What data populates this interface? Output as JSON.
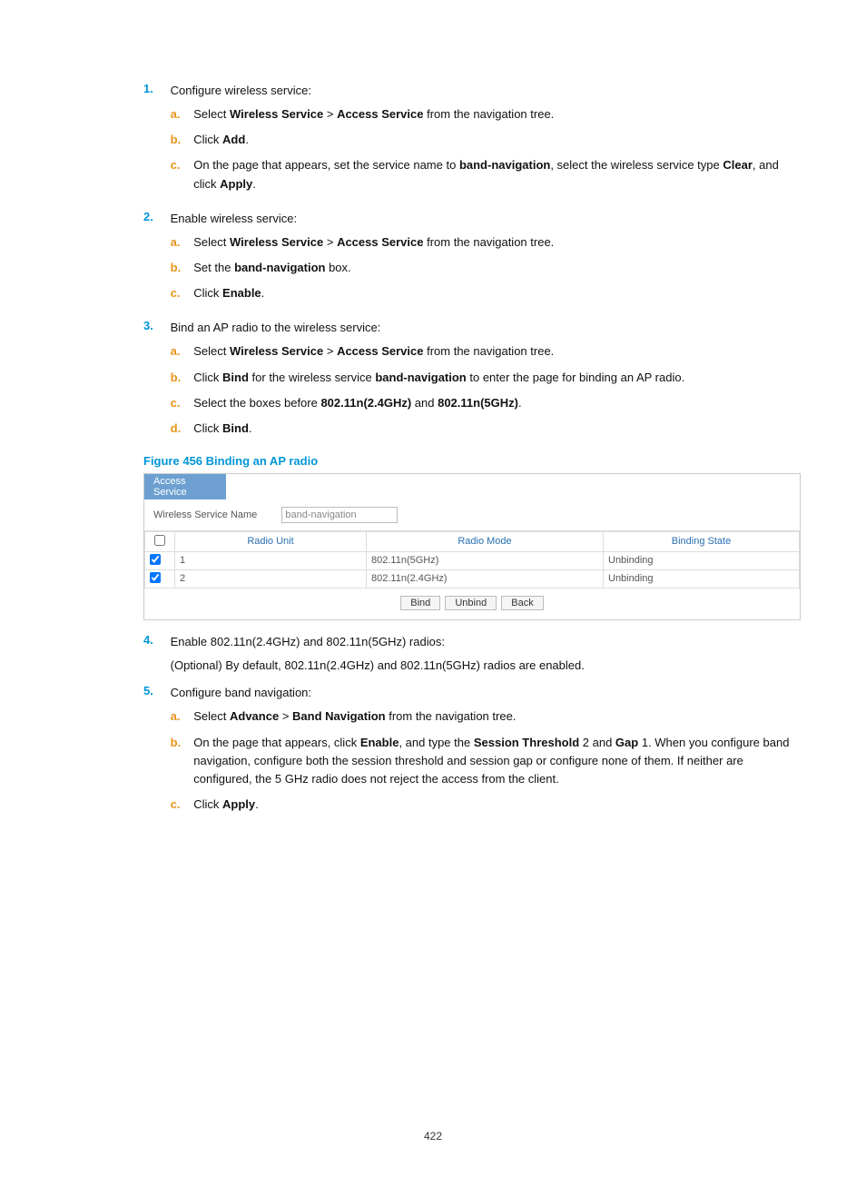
{
  "steps": {
    "s1": {
      "num": "1.",
      "text": "Configure wireless service:"
    },
    "s1a": {
      "alph": "a.",
      "pre": "Select ",
      "b1": "Wireless Service",
      "mid": " > ",
      "b2": "Access Service",
      "post": " from the navigation tree."
    },
    "s1b": {
      "alph": "b.",
      "pre": "Click ",
      "b1": "Add",
      "post": "."
    },
    "s1c": {
      "alph": "c.",
      "pre": "On the page that appears, set the service name to ",
      "b1": "band-navigation",
      "mid": ", select the wireless service type ",
      "b2": "Clear",
      "mid2": ", and click ",
      "b3": "Apply",
      "post": "."
    },
    "s2": {
      "num": "2.",
      "text": "Enable wireless service:"
    },
    "s2a": {
      "alph": "a.",
      "pre": "Select ",
      "b1": "Wireless Service",
      "mid": " > ",
      "b2": "Access Service",
      "post": " from the navigation tree."
    },
    "s2b": {
      "alph": "b.",
      "pre": "Set the ",
      "b1": "band-navigation",
      "post": " box."
    },
    "s2c": {
      "alph": "c.",
      "pre": "Click ",
      "b1": "Enable",
      "post": "."
    },
    "s3": {
      "num": "3.",
      "text": "Bind an AP radio to the wireless service:"
    },
    "s3a": {
      "alph": "a.",
      "pre": "Select ",
      "b1": "Wireless Service",
      "mid": " > ",
      "b2": "Access Service",
      "post": " from the navigation tree."
    },
    "s3b": {
      "alph": "b.",
      "pre": "Click ",
      "b1": "Bind",
      "mid": " for the wireless service ",
      "b2": "band-navigation",
      "post": " to enter the page for binding an AP radio."
    },
    "s3c": {
      "alph": "c.",
      "pre": "Select the boxes before ",
      "b1": "802.11n(2.4GHz)",
      "mid": " and ",
      "b2": "802.11n(5GHz)",
      "post": "."
    },
    "s3d": {
      "alph": "d.",
      "pre": "Click ",
      "b1": "Bind",
      "post": "."
    },
    "s4": {
      "num": "4.",
      "text": "Enable 802.11n(2.4GHz) and 802.11n(5GHz) radios:",
      "line2": "(Optional) By default, 802.11n(2.4GHz) and 802.11n(5GHz) radios are enabled."
    },
    "s5": {
      "num": "5.",
      "text": "Configure band navigation:"
    },
    "s5a": {
      "alph": "a.",
      "pre": "Select ",
      "b1": "Advance",
      "mid": " > ",
      "b2": "Band Navigation",
      "post": " from the navigation tree."
    },
    "s5b": {
      "alph": "b.",
      "pre": "On the page that appears, click ",
      "b1": "Enable",
      "mid": ", and type the ",
      "b2": "Session Threshold",
      "mid2": " 2 and ",
      "b3": "Gap",
      "post": " 1. When you configure band navigation, configure both the session threshold and session gap or configure none of them. If neither are configured, the 5 GHz radio does not reject the access from the client."
    },
    "s5c": {
      "alph": "c.",
      "pre": "Click ",
      "b1": "Apply",
      "post": "."
    }
  },
  "figure": {
    "title": "Figure 456 Binding an AP radio"
  },
  "ui": {
    "tab": "Access Service",
    "fieldlabel": "Wireless Service Name",
    "fieldvalue": "band-navigation",
    "th1": "Radio Unit",
    "th2": "Radio Mode",
    "th3": "Binding State",
    "rows": [
      {
        "unit": "1",
        "mode": "802.11n(5GHz)",
        "state": "Unbinding"
      },
      {
        "unit": "2",
        "mode": "802.11n(2.4GHz)",
        "state": "Unbinding"
      }
    ],
    "btn_bind": "Bind",
    "btn_unbind": "Unbind",
    "btn_back": "Back"
  },
  "pagenum": "422"
}
